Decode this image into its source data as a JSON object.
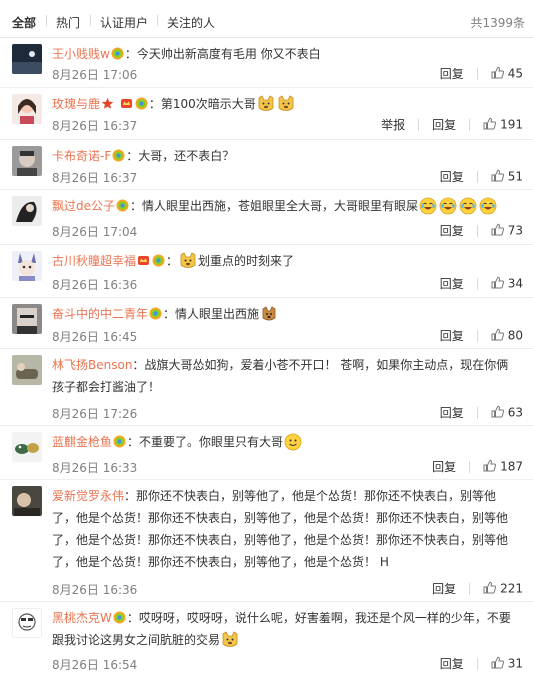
{
  "tabs": [
    "全部",
    "热门",
    "认证用户",
    "关注的人"
  ],
  "total": "共1399条",
  "actions": {
    "reply": "回复",
    "report": "举报"
  },
  "colors": {
    "username": "#eb7350",
    "meta": "#808080",
    "badge_v": "#f0a419"
  },
  "comments": [
    {
      "user": "王小贱贱w",
      "sep": "：",
      "text": "今天帅出新高度有毛用 你又不表白",
      "time": "8月26日 17:06",
      "likes": "45"
    },
    {
      "user": "玫瑰与鹿",
      "sep": "：",
      "text": "第100次暗示大哥",
      "time": "8月26日 16:37",
      "likes": "191"
    },
    {
      "user": "卡布奇诺-F",
      "sep": "：",
      "text": "大哥，还不表白？",
      "time": "8月26日 16:37",
      "likes": "51"
    },
    {
      "user": "飘过de公子",
      "sep": "：",
      "text": "情人眼里出西施，苍姐眼里全大哥，大哥眼里有眼屎",
      "time": "8月26日 17:04",
      "likes": "73"
    },
    {
      "user": "古川秋瞳超幸福",
      "sep": "：",
      "text": "划重点的时刻来了",
      "time": "8月26日 16:36",
      "likes": "34"
    },
    {
      "user": "奋斗中的中二青年",
      "sep": "：",
      "text": "情人眼里出西施",
      "time": "8月26日 16:45",
      "likes": "80"
    },
    {
      "user": "林飞扬Benson",
      "sep": "：",
      "text": "战旗大哥怂如狗，爱着小苍不开口！ 苍啊，如果你主动点，现在你俩孩子都会打酱油了！",
      "time": "8月26日 17:26",
      "likes": "63"
    },
    {
      "user": "蓝麒金枪鱼",
      "sep": "：",
      "text": "不重要了。你眼里只有大哥",
      "time": "8月26日 16:33",
      "likes": "187"
    },
    {
      "user": "爱新觉罗永伟",
      "sep": "：",
      "text": "那你还不快表白，别等他了，他是个怂货！那你还不快表白，别等他了，他是个怂货！那你还不快表白，别等他了，他是个怂货！那你还不快表白，别等他了，他是个怂货！那你还不快表白，别等他了，他是个怂货！那你还不快表白，别等他了，他是个怂货！那你还不快表白，别等他了，他是个怂货！ H",
      "time": "8月26日 16:36",
      "likes": "221"
    },
    {
      "user": "黑桃杰克W",
      "sep": "：",
      "text": "哎呀呀，哎呀呀，说什么呢，好害羞啊，我还是个风一样的少年，不要跟我讨论这男女之间肮脏的交易",
      "time": "8月26日 16:54",
      "likes": "31"
    }
  ]
}
